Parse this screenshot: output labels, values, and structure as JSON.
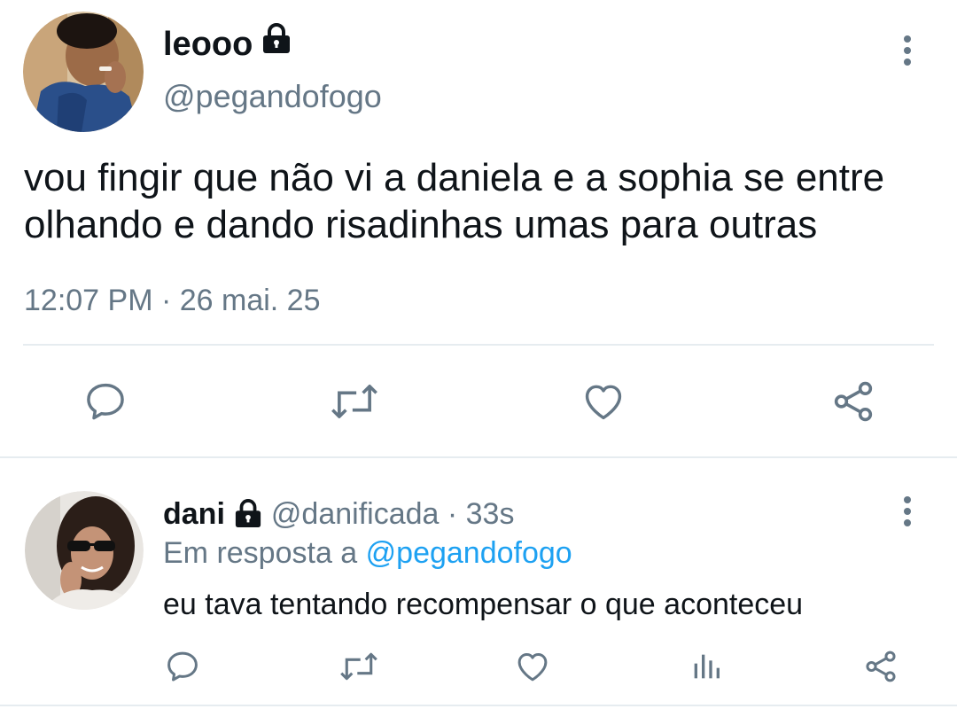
{
  "main_tweet": {
    "display_name": "leooo",
    "handle": "@pegandofogo",
    "protected": true,
    "text": "vou fingir que não vi a daniela e a sophia se entre olhando e dando risadinhas umas para outras",
    "timestamp": "12:07 PM · 26 mai. 25",
    "actions": [
      "reply-icon",
      "retweet-icon",
      "like-icon",
      "share-icon"
    ]
  },
  "reply_tweet": {
    "display_name": "dani",
    "handle_time": "@danificada · 33s",
    "protected": true,
    "reply_to_prefix": "Em resposta a ",
    "reply_to_handle": "@pegandofogo",
    "text": "eu tava tentando recompensar o que aconteceu",
    "actions": [
      "reply-icon",
      "retweet-icon",
      "like-icon",
      "stats-icon",
      "share-icon"
    ]
  },
  "colors": {
    "text": "#0f1419",
    "muted": "#657786",
    "link": "#1da1f2",
    "divider": "#e6ecf0"
  }
}
